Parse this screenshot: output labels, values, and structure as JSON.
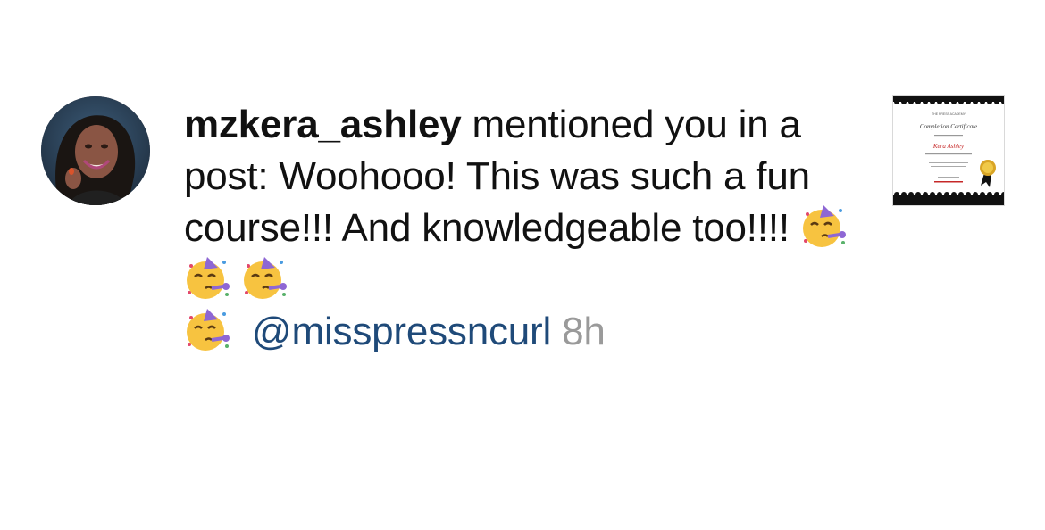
{
  "notification": {
    "username": "mzkera_ashley",
    "line_text": "mentioned you in a post: Woohooo! This was such a fun course!!! And knowledgeable too!!!!",
    "emoji_name": "partying-face-emoji",
    "mention": "@misspressncurl",
    "time": "8h"
  },
  "post_thumbnail": {
    "cert_header": "THE PRESS ACADEMY",
    "cert_title": "Completion Certificate",
    "cert_name": "Kera Ashley"
  },
  "colors": {
    "mention": "#1f4a79",
    "timestamp": "#9a9a9a",
    "text": "#111111"
  }
}
